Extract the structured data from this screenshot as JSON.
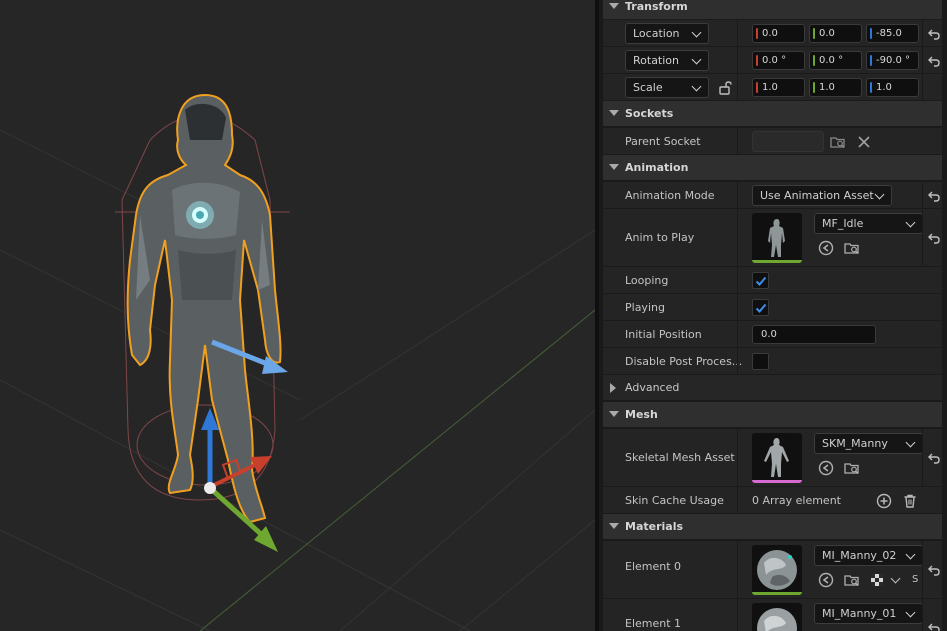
{
  "colors": {
    "selection_outline": "#f0a020",
    "axis_x": "#c8402c",
    "axis_y": "#6ea831",
    "axis_z": "#2f78d8",
    "checkbox_check": "#3d8eea"
  },
  "viewport": {
    "character_icon": "character-mesh-icon",
    "gizmo_icon": "transform-gizmo-icon"
  },
  "transform": {
    "title": "Transform",
    "location": {
      "label": "Location",
      "x": "0.0",
      "y": "0.0",
      "z": "-85.0"
    },
    "rotation": {
      "label": "Rotation",
      "x": "0.0 °",
      "y": "0.0 °",
      "z": "-90.0 °"
    },
    "scale": {
      "label": "Scale",
      "x": "1.0",
      "y": "1.0",
      "z": "1.0"
    }
  },
  "sockets": {
    "title": "Sockets",
    "parent_socket_label": "Parent Socket",
    "parent_socket_value": ""
  },
  "animation": {
    "title": "Animation",
    "mode_label": "Animation Mode",
    "mode_value": "Use Animation Asset",
    "anim_to_play_label": "Anim to Play",
    "anim_asset": "MF_Idle",
    "looping_label": "Looping",
    "looping": true,
    "playing_label": "Playing",
    "playing": true,
    "initial_position_label": "Initial Position",
    "initial_position_value": "0.0",
    "disable_post_label": "Disable Post Proces...",
    "disable_post": false
  },
  "advanced": {
    "title": "Advanced"
  },
  "mesh": {
    "title": "Mesh",
    "skeletal_mesh_label": "Skeletal Mesh Asset",
    "skeletal_mesh_value": "SKM_Manny",
    "skin_cache_label": "Skin Cache Usage",
    "skin_cache_value": "0 Array element"
  },
  "materials": {
    "title": "Materials",
    "elements": [
      {
        "label": "Element 0",
        "value": "MI_Manny_02",
        "extra": "S"
      },
      {
        "label": "Element 1",
        "value": "MI_Manny_01"
      }
    ]
  }
}
